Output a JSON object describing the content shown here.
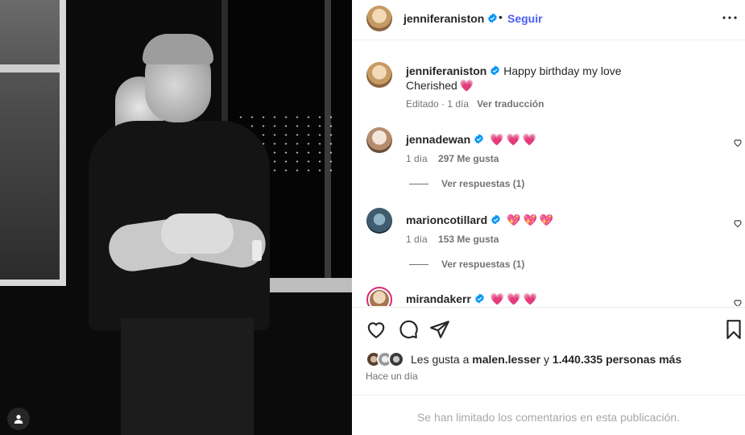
{
  "post": {
    "username": "jenniferaniston",
    "follow_label": "Seguir",
    "separator": "•"
  },
  "caption": {
    "username": "jenniferaniston",
    "text": "Happy birthday my love",
    "text_line2": "Cherished",
    "emoji": "💗",
    "meta_time": "Editado · 1 día",
    "translate_label": "Ver traducción"
  },
  "comments": [
    {
      "username": "jennadewan",
      "emojis": [
        "💗",
        "💗",
        "💗"
      ],
      "time": "1 día",
      "likes": "297 Me gusta",
      "replies_label": "Ver respuestas (1)"
    },
    {
      "username": "marioncotillard",
      "emojis": [
        "💖",
        "💖",
        "💖"
      ],
      "time": "1 día",
      "likes": "153 Me gusta",
      "replies_label": "Ver respuestas (1)"
    },
    {
      "username": "mirandakerr",
      "emojis": [
        "💗",
        "💗",
        "💗"
      ]
    }
  ],
  "likes": {
    "prefix": "Les gusta a",
    "user": "malen.lesser",
    "middle": "y",
    "count_text": "1.440.335 personas más"
  },
  "time_ago": "Hace un día",
  "limited_comments_text": "Se han limitado los comentarios en esta publicación.",
  "colors": {
    "follow_blue": "#4a5df9",
    "verified_blue": "#0095f6",
    "meta_gray": "#737373",
    "heart_pink": "#e8326d"
  },
  "icons": [
    "more-options-icon",
    "verified-badge-icon",
    "heart-icon",
    "comment-icon",
    "share-icon",
    "bookmark-icon",
    "user-tag-icon"
  ]
}
